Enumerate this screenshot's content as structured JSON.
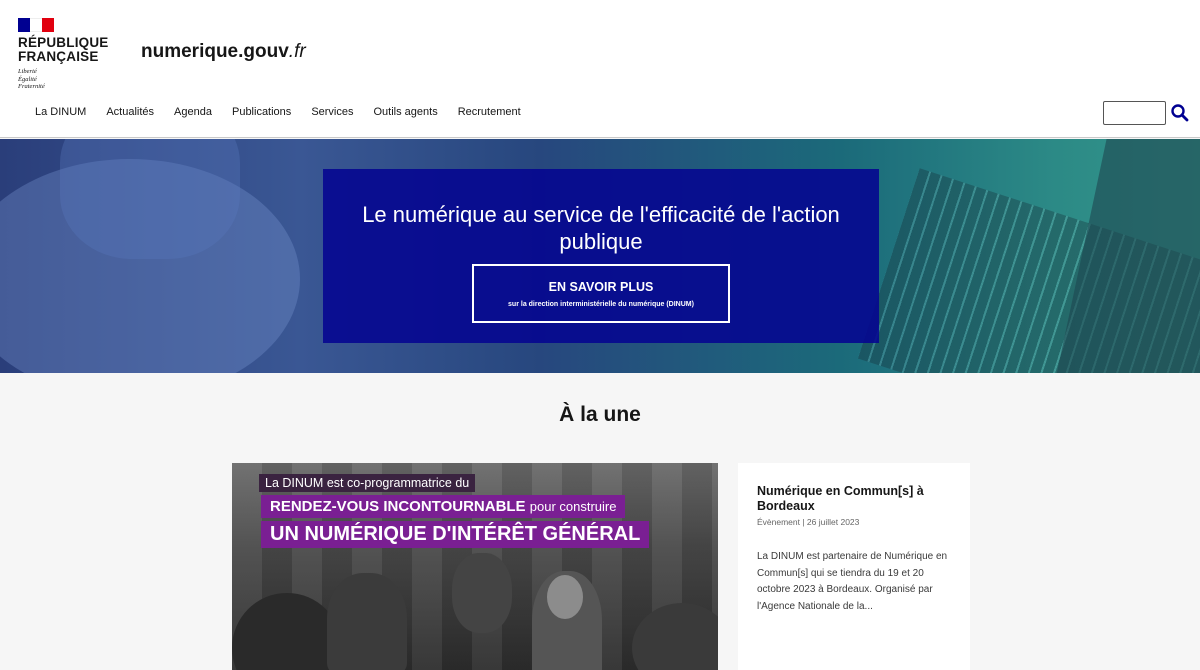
{
  "header": {
    "republique": "RÉPUBLIQUE\nFRANÇAISE",
    "devise": "Liberté\nÉgalité\nFraternité",
    "site_name": "numerique.gouv",
    "site_tld": ".fr",
    "search_placeholder": ""
  },
  "nav": {
    "items": [
      {
        "label": "La DINUM"
      },
      {
        "label": "Actualités"
      },
      {
        "label": "Agenda"
      },
      {
        "label": "Publications"
      },
      {
        "label": "Services"
      },
      {
        "label": "Outils agents"
      },
      {
        "label": "Recrutement"
      }
    ]
  },
  "hero": {
    "title": "Le numérique au service de l'efficacité de l'action publique",
    "cta_label": "EN SAVOIR PLUS",
    "cta_sub": "sur la direction interministérielle du numérique (DINUM)"
  },
  "section": {
    "title": "À la une"
  },
  "featured": {
    "image_line1": "La DINUM est co-programmatrice du",
    "image_line2": "RENDEZ-VOUS INCONTOURNABLE",
    "image_line2b": "pour construire",
    "image_line3": "UN NUMÉRIQUE D'INTÉRÊT GÉNÉRAL",
    "title": "Numérique en Commun[s] à Bordeaux",
    "meta": "Évènement | 26 juillet 2023",
    "description": "La DINUM est partenaire de Numérique en Commun[s] qui se tiendra du 19 et 20 octobre 2023 à Bordeaux. Organisé par l'Agence Nationale de la..."
  },
  "colors": {
    "brand_blue": "#000091",
    "brand_red": "#e1000f",
    "accent_purple": "#7a1f93"
  },
  "icons": {
    "search": "search-icon",
    "flag": "marianne-flag-icon"
  }
}
